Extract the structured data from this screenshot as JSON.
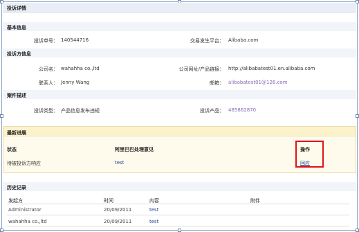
{
  "page": {
    "title": "投诉详情"
  },
  "basic_info": {
    "heading": "基本信息",
    "complaint_no_label": "投诉单号：",
    "complaint_no": "140544716",
    "platform_label": "交易发生平台：",
    "platform": "Alibaba.com"
  },
  "complainant": {
    "heading": "投诉方信息",
    "company_label": "公司名：",
    "company": "wahahha co.,ltd",
    "website_label": "公司网址/产品链接：",
    "website": "http://alibabatest01.en.alibaba.com",
    "contact_label": "联系人：",
    "contact": "Jenny Wang",
    "email_label": "邮箱：",
    "email": "alibabatest01@126.com"
  },
  "case": {
    "heading": "案件描述",
    "type_label": "投诉类型：",
    "type": "产品信息发布违规",
    "product_label": "投诉产品：",
    "product": "485862870"
  },
  "progress": {
    "heading": "最新进展",
    "col_status": "状态",
    "col_opinion": "阿里巴巴处理意见",
    "col_action": "操作",
    "status": "待被投诉方响应",
    "opinion": "test",
    "action": "回应"
  },
  "history": {
    "heading": "历史记录",
    "columns": [
      "发起方",
      "时间",
      "内容",
      "附件"
    ],
    "rows": [
      [
        "Administrator",
        "20/09/2011",
        "test",
        ""
      ],
      [
        "wahahha co.,ltd",
        "20/09/2011",
        "test",
        ""
      ]
    ]
  }
}
